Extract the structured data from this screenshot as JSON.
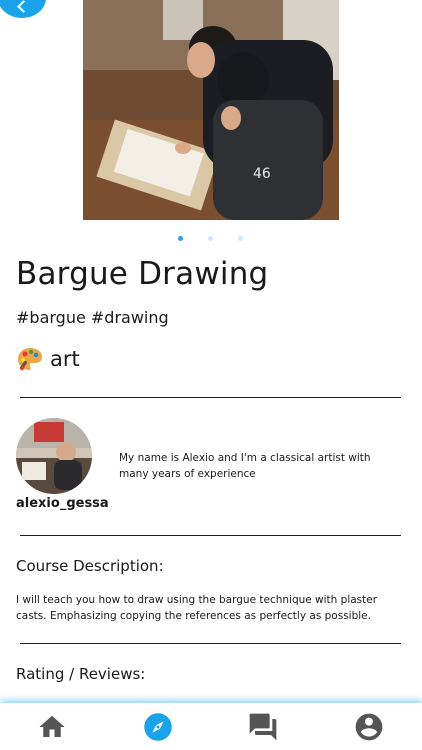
{
  "course": {
    "title": "Bargue Drawing",
    "tags": "#bargue #drawing",
    "category": "art",
    "category_icon": "artist-palette-icon"
  },
  "carousel": {
    "total": 3,
    "active_index": 0
  },
  "instructor": {
    "username": "alexio_gessa",
    "bio": "My name is Alexio and I'm a classical artist with many years of experience"
  },
  "description": {
    "heading": "Course Description:",
    "text": "I will teach you how to draw using the bargue technique with plaster casts. Emphasizing copying the references as perfectly as possible."
  },
  "reviews": {
    "heading": "Rating / Reviews:"
  },
  "nav": {
    "items": [
      {
        "icon": "home-icon",
        "active": false
      },
      {
        "icon": "compass-icon",
        "active": true
      },
      {
        "icon": "chat-icon",
        "active": false
      },
      {
        "icon": "account-icon",
        "active": false
      }
    ]
  },
  "colors": {
    "accent": "#1aa3e8",
    "nav_inactive": "#555555"
  }
}
